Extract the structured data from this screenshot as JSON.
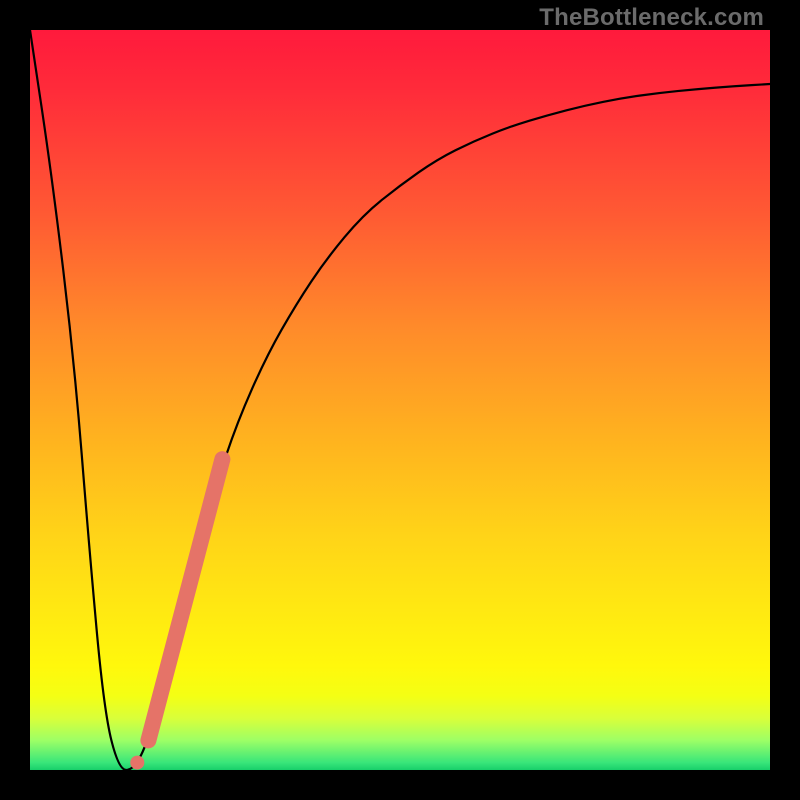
{
  "watermark": "TheBottleneck.com",
  "colors": {
    "frame": "#000000",
    "curve": "#000000",
    "marker": "#e57368",
    "gradient_top": "#ff1a3c",
    "gradient_bottom": "#18cf6a"
  },
  "chart_data": {
    "type": "line",
    "title": "",
    "xlabel": "",
    "ylabel": "",
    "xlim": [
      0,
      100
    ],
    "ylim": [
      0,
      100
    ],
    "grid": false,
    "legend": false,
    "x": [
      0,
      3,
      6,
      8,
      10,
      12,
      14,
      16,
      18,
      20,
      22,
      25,
      28,
      32,
      36,
      40,
      45,
      50,
      55,
      60,
      65,
      70,
      75,
      80,
      85,
      90,
      95,
      100
    ],
    "y": [
      100,
      80,
      55,
      30,
      8,
      0,
      0,
      4,
      12,
      20,
      28,
      38,
      47,
      56,
      63,
      69,
      75,
      79,
      82.5,
      85,
      87,
      88.5,
      89.8,
      90.8,
      91.5,
      92,
      92.4,
      92.7
    ],
    "annotations": [
      {
        "type": "segment",
        "x0": 16,
        "y0": 4,
        "x1": 26,
        "y1": 42,
        "note": "highlighted marker streak"
      },
      {
        "type": "point",
        "x": 14.5,
        "y": 1
      },
      {
        "type": "point",
        "x": 16.5,
        "y": 6
      },
      {
        "type": "point",
        "x": 17.5,
        "y": 10
      }
    ]
  }
}
